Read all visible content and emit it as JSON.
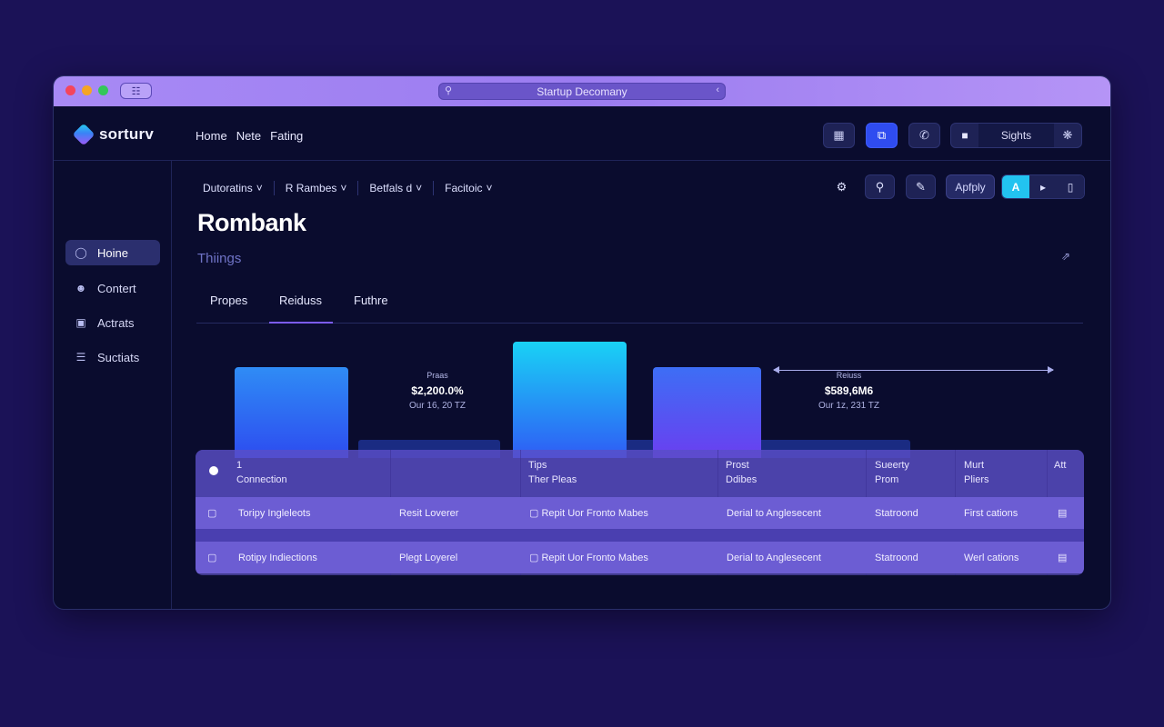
{
  "window": {
    "title": "Startup Decomany"
  },
  "header": {
    "logo_text": "sorturv",
    "nav": [
      "Home",
      "Nete",
      "Fating"
    ],
    "sights_label": "Sights"
  },
  "sidebar": {
    "items": [
      {
        "label": "Hoine",
        "icon": "home-icon",
        "active": true
      },
      {
        "label": "Contert",
        "icon": "user-icon",
        "active": false
      },
      {
        "label": "Actrats",
        "icon": "briefcase-icon",
        "active": false
      },
      {
        "label": "Suctiats",
        "icon": "list-icon",
        "active": false
      }
    ]
  },
  "filters": [
    {
      "label": "Dutoratins"
    },
    {
      "label": "R Rambes"
    },
    {
      "label": "Betfals d"
    },
    {
      "label": "Facitoic"
    }
  ],
  "toolbar": {
    "apply_label": "Apfply",
    "segment_active": "A"
  },
  "page": {
    "title": "Rombank",
    "subtitle": "Thiings"
  },
  "tabs": [
    {
      "label": "Propes",
      "active": false
    },
    {
      "label": "Reiduss",
      "active": true
    },
    {
      "label": "Futhre",
      "active": false
    }
  ],
  "chart_data": {
    "type": "bar",
    "title": "",
    "annotations": [
      {
        "label": "Praas",
        "value": "$2,200.0%",
        "sub": "Our 16, 20 TZ"
      },
      {
        "label": "Reiuss",
        "value": "$589,6M6",
        "sub": "Our 1z, 231 TZ"
      }
    ],
    "colors": {
      "bar_gradient_top": "#2f6cf5",
      "bar_gradient_cyan": "#19d2f5",
      "bar_gradient_violet": "#6a3ff0",
      "baseline_bar": "#1a2b82"
    }
  },
  "table": {
    "headers": [
      {
        "line1": "1",
        "line2": "Connection"
      },
      {
        "line1": "",
        "line2": ""
      },
      {
        "line1": "Tips",
        "line2": "Ther Pleas"
      },
      {
        "line1": "Prost",
        "line2": "Ddibes"
      },
      {
        "line1": "Sueerty",
        "line2": "Prom"
      },
      {
        "line1": "Murt",
        "line2": "Pliers"
      },
      {
        "line1": "Att",
        "line2": ""
      }
    ],
    "rows": [
      [
        "Toripy Ingleleots",
        "Resit Loverer",
        "Repit Uor Fronto Mabes",
        "Derial to Anglesecent",
        "Statroond",
        "First cations"
      ],
      [
        "Rotipy Indiections",
        "Plegt Loyerel",
        "Repit Uor Fronto Mabes",
        "Derial to Anglesecent",
        "Statroond",
        "Werl cations"
      ]
    ]
  },
  "colors": {
    "background": "#1b1257",
    "window": "#0a0c2e",
    "titlebar": "#a88af5",
    "accent": "#2f4cf0",
    "tab_underline": "#7c5cf2",
    "segment_active": "#22c3f0"
  }
}
